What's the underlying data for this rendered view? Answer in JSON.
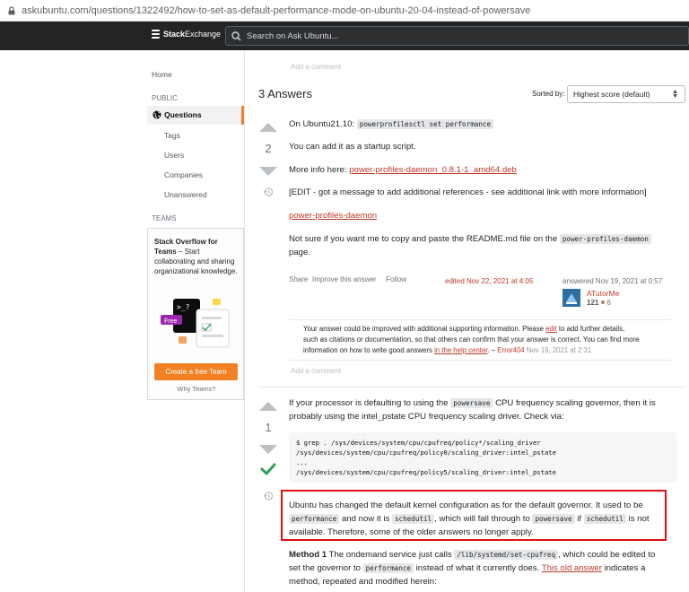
{
  "browser": {
    "url": "askubuntu.com/questions/1322492/how-to-set-as-default-performance-mode-on-ubuntu-20-04-instead-of-powersave"
  },
  "header": {
    "brand_part1": "Stack",
    "brand_part2": "Exchange",
    "search_placeholder": "Search on Ask Ubuntu..."
  },
  "sidebar": {
    "home": "Home",
    "public_label": "PUBLIC",
    "questions": "Questions",
    "tags": "Tags",
    "users": "Users",
    "companies": "Companies",
    "unanswered": "Unanswered",
    "teams_label": "TEAMS",
    "teams_title": "Stack Overflow for Teams",
    "teams_desc": " – Start collaborating and sharing organizational knowledge.",
    "free_badge": "Free",
    "create_team": "Create a free Team",
    "why_teams": "Why Teams?"
  },
  "question_tail": {
    "add_comment": "Add a comment"
  },
  "answers_header": {
    "count": "3 Answers",
    "sorted_by": "Sorted by:",
    "sort_value": "Highest score (default)"
  },
  "answer1": {
    "score": "2",
    "line1_prefix": "On Ubuntu21.10: ",
    "line1_code": "powerprofilesctl set performance",
    "line2": "You can add it as a startup script.",
    "line3_prefix": "More info here: ",
    "line3_link": "power-profiles-daemon_0.8.1-1_amd64.deb",
    "line4": "[EDIT - got a message to add additional references - see additional link with more information]",
    "line5_link": "power-profiles-daemon",
    "line6_prefix": "Not sure if you want me to copy and paste the README.md file on the ",
    "line6_code": "power-profiles-daemon",
    "line7": "page.",
    "share": "Share",
    "improve": "Improve this answer",
    "follow": "Follow",
    "edited": "edited Nov 22, 2021 at 4:05",
    "answered": "answered Nov 19, 2021 at 0:57",
    "user_name": "ATutorMe",
    "user_rep": "121",
    "user_badges": "6",
    "comment_part1": "Your answer could be improved with additional supporting information. Please ",
    "comment_edit": "edit",
    "comment_part2": " to add further details,",
    "comment_line2": "such as citations or documentation, so that others can confirm that your answer is correct. You can find more",
    "comment_part3": "information on how to write good answers ",
    "comment_help": "in the help center",
    "comment_dash": ". – ",
    "comment_user": "Error404",
    "comment_date": " Nov 19, 2021 at 2:31",
    "add_comment": "Add a comment"
  },
  "answer2": {
    "score": "1",
    "p1_prefix": "If your processor is defaulting to using the ",
    "p1_code": "powersave",
    "p1_suffix": " CPU frequency scaling governor, then it is",
    "p1_line2": "probably using the intel_pstate CPU frequency scaling driver. Check via:",
    "code": "$ grep . /sys/devices/system/cpu/cpufreq/policy*/scaling_driver\n/sys/devices/system/cpu/cpufreq/policy0/scaling_driver:intel_pstate\n...\n/sys/devices/system/cpu/cpufreq/policy5/scaling_driver:intel_pstate",
    "hl_line1": "Ubuntu has changed the default kernel configuration as for the default governor. It used to be",
    "hl_code1": "performance",
    "hl_mid1": " and now it is ",
    "hl_code2": "schedutil",
    "hl_mid2": ", which will fall through to ",
    "hl_code3": "powersave",
    "hl_mid3": " if ",
    "hl_code4": "schedutil",
    "hl_mid4": " is not",
    "hl_line3": "available. Therefore, some of the older answers no longer apply.",
    "m1_bold": "Method 1",
    "m1_prefix": " The ondemand service just calls ",
    "m1_code": "/lib/systemd/set-cpufreq",
    "m1_suffix": ", which could be edited to",
    "m1_l2_prefix": "set the governor to ",
    "m1_l2_code": "performance",
    "m1_l2_mid": " instead of what it currently does. ",
    "m1_l2_link": "This old answer",
    "m1_l2_suffix": " indicates a",
    "m1_l3": "method, repeated and modified herein:"
  },
  "colors": {
    "accent": "#f48024",
    "link": "#c0392b",
    "highlight_border": "#e01010",
    "accepted_check": "#2f9e5a"
  }
}
